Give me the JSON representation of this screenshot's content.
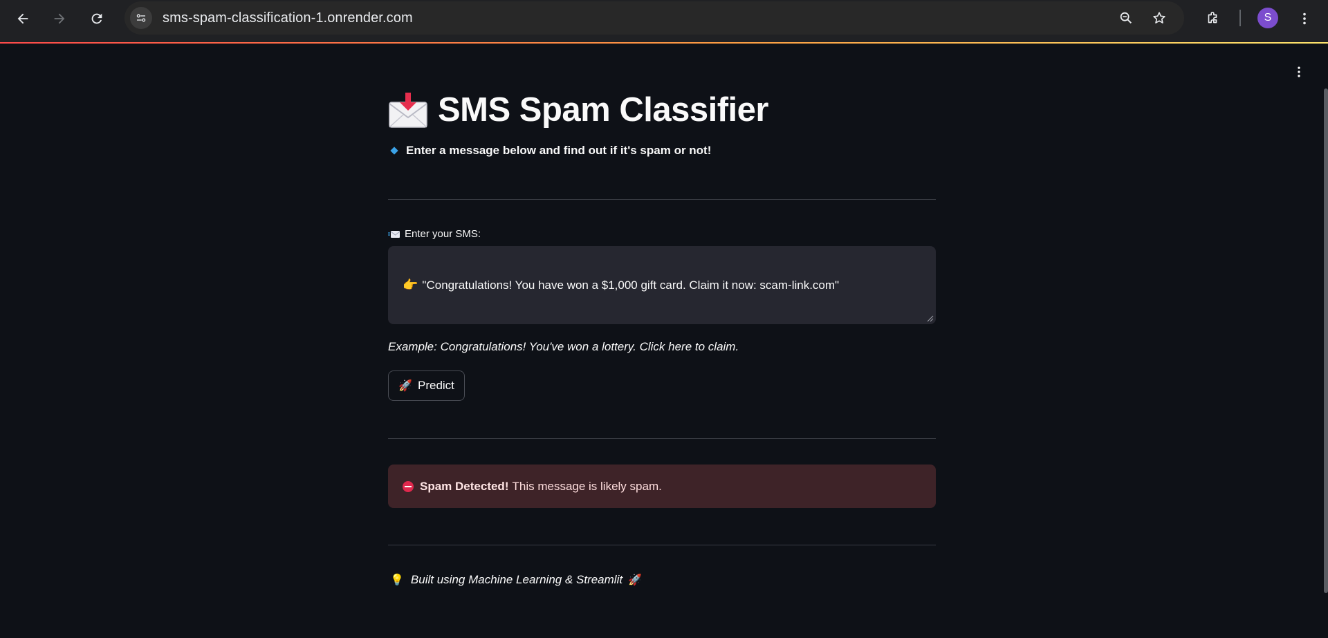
{
  "browser": {
    "url": "sms-spam-classification-1.onrender.com",
    "avatar_letter": "S",
    "icons": [
      "back-arrow-icon",
      "forward-arrow-icon",
      "reload-icon",
      "site-info-icon",
      "zoom-icon",
      "bookmark-star-icon",
      "extensions-icon",
      "more-vert-icon"
    ]
  },
  "app": {
    "title": "SMS Spam Classifier",
    "subtitle": "Enter a message below and find out if it's spam or not!",
    "input_label": "Enter your SMS:",
    "input_value": "\"Congratulations! You have won a $1,000 gift card. Claim it now: scam-link.com\"",
    "example_caption": "Example: Congratulations! You've won a lottery. Click here to claim.",
    "predict_label": "Predict",
    "result": {
      "heading": "Spam Detected!",
      "message": "This message is likely spam."
    },
    "footer": "Built using Machine Learning & Streamlit"
  },
  "colors": {
    "background": "#0e1117",
    "input_bg": "#262730",
    "error_bg": "#3e2328",
    "accent_line_start": "#ff4b4b",
    "accent_line_end": "#ffe66d"
  }
}
